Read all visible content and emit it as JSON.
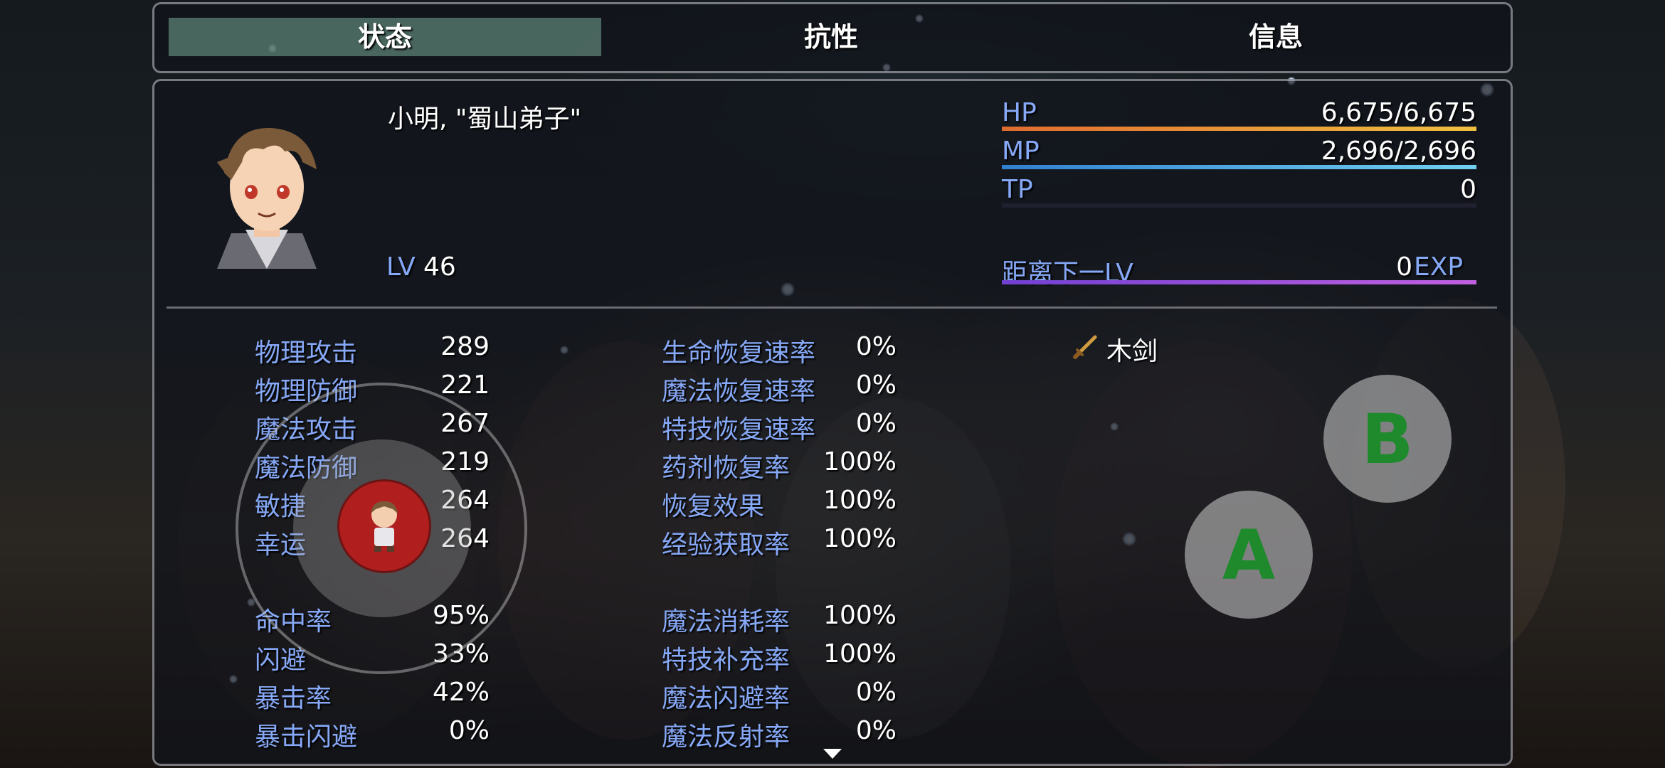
{
  "tabs": {
    "status": "状态",
    "resist": "抗性",
    "info": "信息"
  },
  "actor": {
    "name_title": "小明, \"蜀山弟子\"",
    "level_label": "LV",
    "level": "46",
    "hp_label": "HP",
    "hp": "6,675/6,675",
    "hp_fraction": 1.0,
    "mp_label": "MP",
    "mp": "2,696/2,696",
    "mp_fraction": 1.0,
    "tp_label": "TP",
    "tp": "0",
    "tp_fraction": 0.0,
    "next_label": "距离下一LV",
    "next_value": "0",
    "exp_unit": "EXP"
  },
  "params": [
    {
      "label": "物理攻击",
      "value": "289"
    },
    {
      "label": "物理防御",
      "value": "221"
    },
    {
      "label": "魔法攻击",
      "value": "267"
    },
    {
      "label": "魔法防御",
      "value": "219"
    },
    {
      "label": "敏捷",
      "value": "264"
    },
    {
      "label": "幸运",
      "value": "264"
    }
  ],
  "xparams": [
    {
      "label": "命中率",
      "value": "95%"
    },
    {
      "label": "闪避",
      "value": "33%"
    },
    {
      "label": "暴击率",
      "value": "42%"
    },
    {
      "label": "暴击闪避",
      "value": "0%"
    }
  ],
  "sparams1": [
    {
      "label": "生命恢复速率",
      "value": "0%"
    },
    {
      "label": "魔法恢复速率",
      "value": "0%"
    },
    {
      "label": "特技恢复速率",
      "value": "0%"
    },
    {
      "label": "药剂恢复率",
      "value": "100%"
    },
    {
      "label": "恢复效果",
      "value": "100%"
    },
    {
      "label": "经验获取率",
      "value": "100%"
    }
  ],
  "sparams2": [
    {
      "label": "魔法消耗率",
      "value": "100%"
    },
    {
      "label": "特技补充率",
      "value": "100%"
    },
    {
      "label": "魔法闪避率",
      "value": "0%"
    },
    {
      "label": "魔法反射率",
      "value": "0%"
    }
  ],
  "equipment": [
    {
      "icon": "sword-icon",
      "name": "木剑"
    }
  ],
  "buttons": {
    "a": "A",
    "b": "B"
  },
  "colors": {
    "system": "#86a8f6",
    "hp": "#e0803a",
    "mp": "#40a0e0",
    "exp": "#a050e0",
    "tab_selected": "#78aa96",
    "button_letter": "#1e8a2c"
  }
}
